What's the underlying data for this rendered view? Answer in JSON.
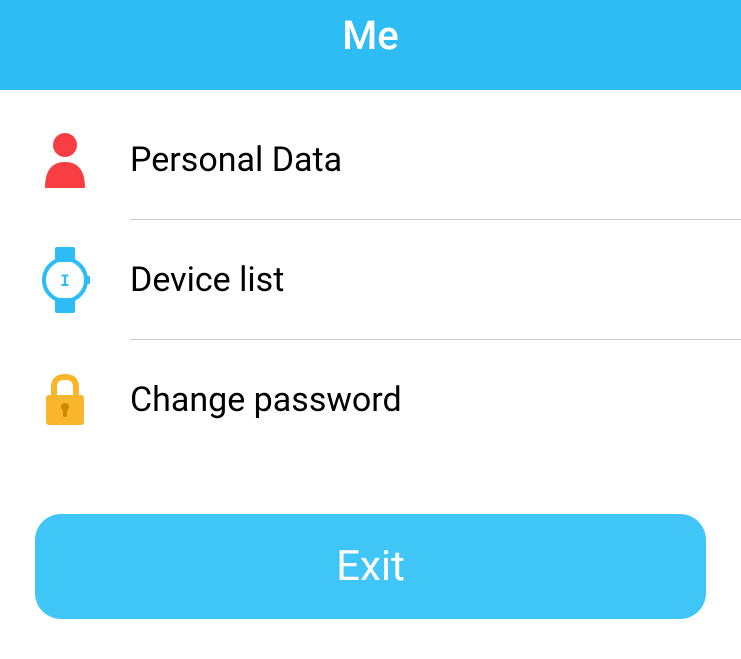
{
  "header": {
    "title": "Me"
  },
  "menu": {
    "items": [
      {
        "icon": "person-icon",
        "label": "Personal Data"
      },
      {
        "icon": "watch-icon",
        "label": "Device list"
      },
      {
        "icon": "lock-icon",
        "label": "Change password"
      }
    ]
  },
  "buttons": {
    "exit_label": "Exit"
  },
  "colors": {
    "header_bg": "#2dbdf4",
    "button_bg": "#40c6f6",
    "person_icon": "#f83e42",
    "watch_icon": "#2dbdf4",
    "lock_icon": "#f9b52c"
  }
}
